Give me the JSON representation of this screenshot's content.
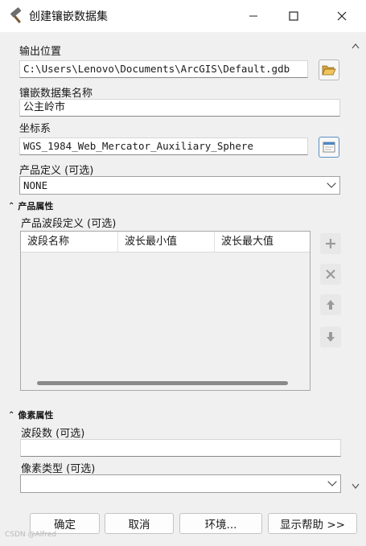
{
  "window": {
    "title": "创建镶嵌数据集"
  },
  "fields": {
    "output_location": {
      "label": "输出位置",
      "value": "C:\\Users\\Lenovo\\Documents\\ArcGIS\\Default.gdb"
    },
    "dataset_name": {
      "label": "镶嵌数据集名称",
      "value": "公主岭市"
    },
    "coordinate_system": {
      "label": "坐标系",
      "value": "WGS_1984_Web_Mercator_Auxiliary_Sphere"
    },
    "product_definition": {
      "label": "产品定义 (可选)",
      "value": "NONE"
    }
  },
  "product_properties": {
    "section_title": "产品属性",
    "band_definition_label": "产品波段定义 (可选)",
    "columns": [
      "波段名称",
      "波长最小值",
      "波长最大值"
    ],
    "rows": []
  },
  "pixel_properties": {
    "section_title": "像素属性",
    "band_count": {
      "label": "波段数 (可选)",
      "value": ""
    },
    "pixel_type": {
      "label": "像素类型 (可选)",
      "value": ""
    }
  },
  "buttons": {
    "ok": "确定",
    "cancel": "取消",
    "environments": "环境...",
    "show_help": "显示帮助 >>"
  },
  "icons": {
    "title": "hammer-icon",
    "browse": "folder-open-icon",
    "spatial_ref": "spatial-reference-icon",
    "add": "plus-icon",
    "delete": "x-icon",
    "up": "arrow-up-icon",
    "down": "arrow-down-icon"
  },
  "watermark": "CSDN @Alfred"
}
